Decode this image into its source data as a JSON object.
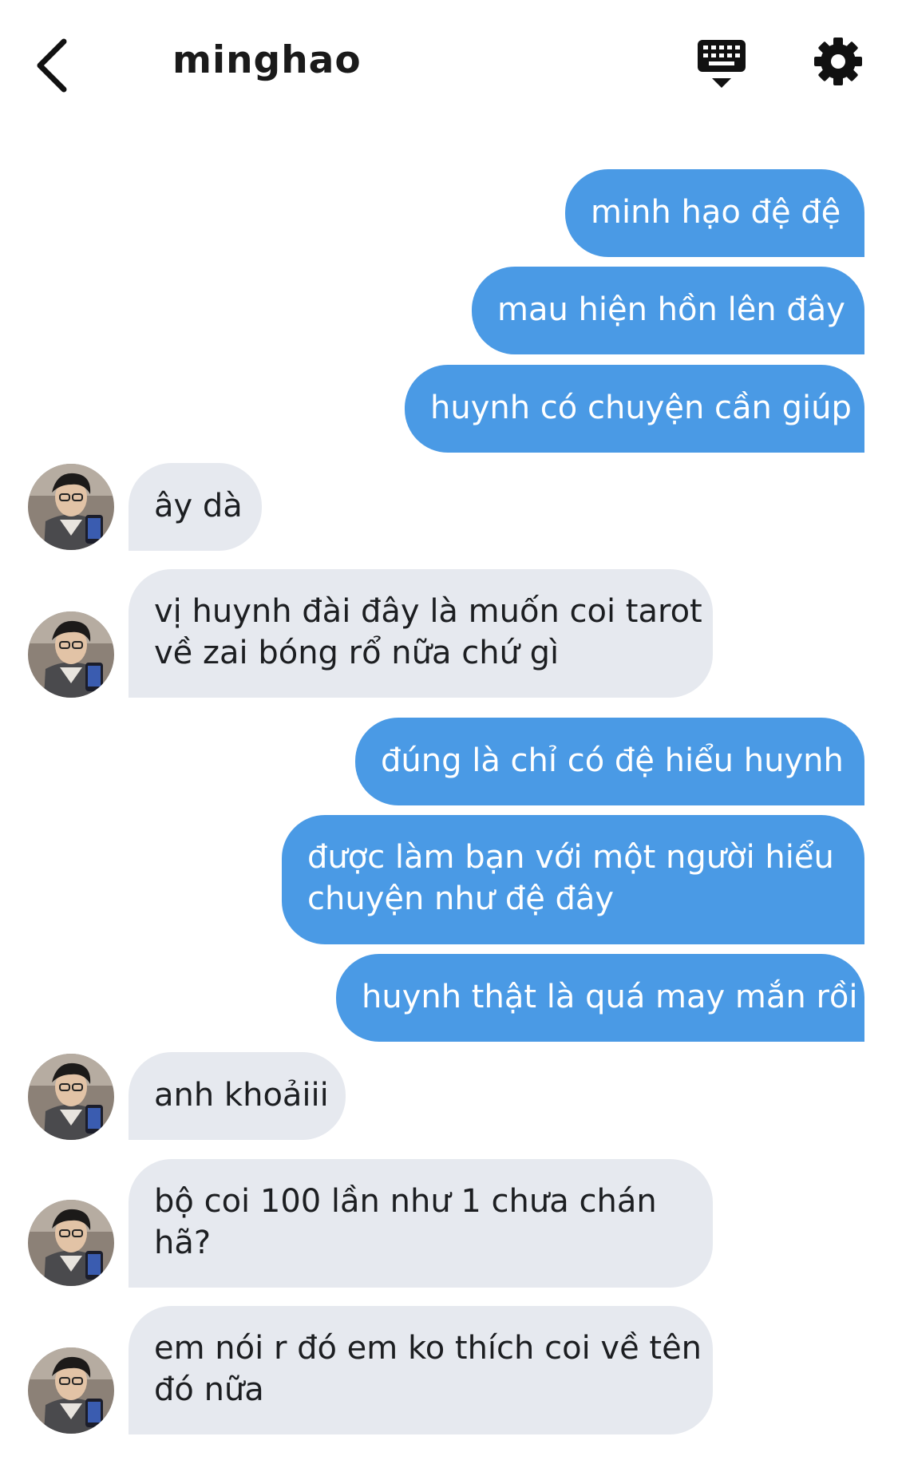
{
  "header": {
    "title": "minghao",
    "back_icon": "chevron-left-icon",
    "keyboard_icon": "keyboard-icon",
    "settings_icon": "gear-icon"
  },
  "colors": {
    "outgoing_bubble": "#4a9ae5",
    "incoming_bubble": "#e6e9ef",
    "text_dark": "#1c1e21"
  },
  "messages": [
    {
      "dir": "out",
      "lines": [
        "minh hạo đệ đệ"
      ]
    },
    {
      "dir": "out",
      "lines": [
        "mau hiện hồn lên đây"
      ]
    },
    {
      "dir": "out",
      "lines": [
        "huynh có chuyện cần giúp"
      ]
    },
    {
      "dir": "in",
      "lines": [
        "ây dà"
      ]
    },
    {
      "dir": "in",
      "lines": [
        "vị huynh đài đây là muốn coi tarot",
        "về zai bóng rổ nữa chứ gì"
      ]
    },
    {
      "dir": "out",
      "lines": [
        "đúng là chỉ có đệ hiểu huynh"
      ]
    },
    {
      "dir": "out",
      "lines": [
        "được làm bạn với một người hiểu",
        "chuyện như đệ đây"
      ]
    },
    {
      "dir": "out",
      "lines": [
        "huynh thật là quá may mắn rồi"
      ]
    },
    {
      "dir": "in",
      "lines": [
        "anh khoảiii"
      ]
    },
    {
      "dir": "in",
      "lines": [
        "bộ coi 100 lần như 1 chưa chán",
        "hã?"
      ]
    },
    {
      "dir": "in",
      "lines": [
        "em nói r đó em ko thích coi về tên",
        "đó nữa"
      ]
    }
  ]
}
